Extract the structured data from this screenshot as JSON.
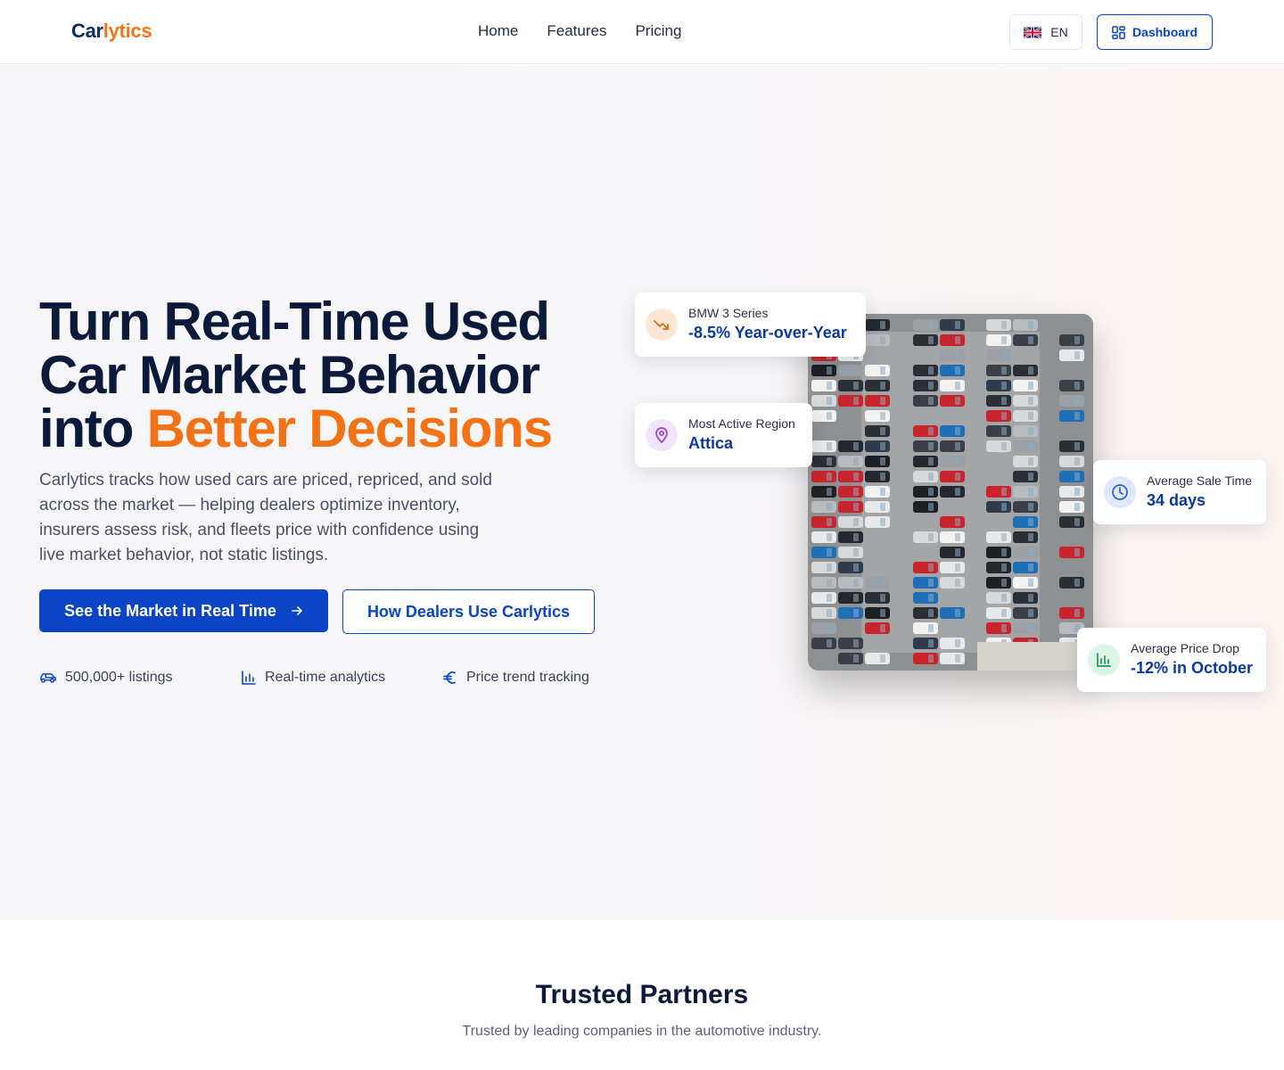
{
  "brand": {
    "part1": "Car",
    "part2": "lytics",
    "primary": "#0b2a66",
    "accent": "#f47216"
  },
  "nav": {
    "items": [
      "Home",
      "Features",
      "Pricing"
    ],
    "language": "EN",
    "dashboard_label": "Dashboard"
  },
  "hero": {
    "headline_line1": "Turn Real-Time Used",
    "headline_line2": "Car Market Behavior",
    "headline_line3_prefix": "into ",
    "headline_accent": "Better Decisions",
    "subtitle": "Carlytics tracks how used cars are priced, repriced, and sold across the market — helping dealers optimize inventory, insurers assess risk, and fleets price with confidence using live market behavior, not static listings.",
    "cta_primary": "See the Market in Real Time",
    "cta_secondary": "How Dealers Use Carlytics",
    "features": [
      "500,000+ listings",
      "Real-time analytics",
      "Price trend tracking"
    ]
  },
  "cards": {
    "bmw": {
      "label": "BMW 3 Series",
      "value": "-8.5% Year-over-Year"
    },
    "region": {
      "label": "Most Active Region",
      "value": "Attica"
    },
    "sale_time": {
      "label": "Average Sale Time",
      "value": "34 days"
    },
    "price_drop": {
      "label": "Average Price Drop",
      "value": "-12% in October"
    }
  },
  "partners": {
    "title": "Trusted Partners",
    "subtitle": "Trusted by leading companies in the automotive industry."
  },
  "colors": {
    "button_blue": "#0a44c7",
    "value_blue": "#0a3a9e"
  }
}
